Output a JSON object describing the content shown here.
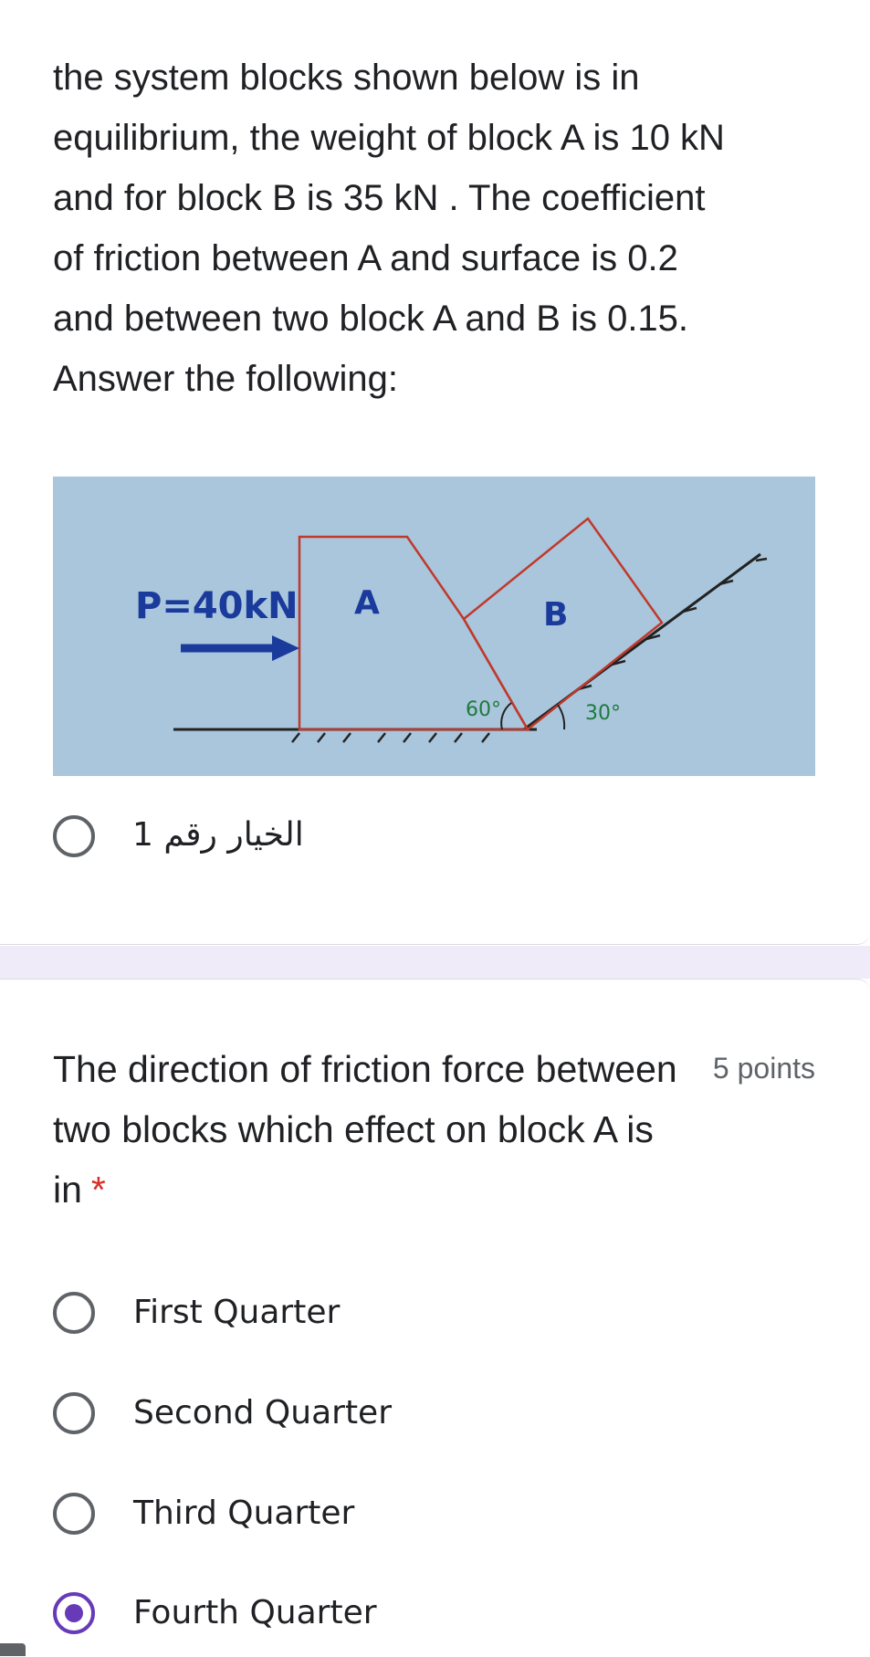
{
  "section_description": {
    "lines": [
      "the system blocks shown below is in",
      "equilibrium, the weight of block A is 10 kN",
      "and for block B is 35 kN . The coefficient",
      "of friction between A and surface is 0.2",
      "and between two block A and B is 0.15.",
      "Answer the following:"
    ]
  },
  "figure": {
    "force_label": "P=40kN",
    "block_a_label": "A",
    "block_b_label": "B",
    "angle_left": "60°",
    "angle_right": "30°"
  },
  "section_option": {
    "label": "الخيار رقم 1",
    "selected": false
  },
  "question": {
    "title": "The direction of friction force between two blocks which effect on block A is in",
    "required_mark": "*",
    "points": "5 points",
    "options": [
      {
        "label": "First Quarter",
        "selected": false
      },
      {
        "label": "Second Quarter",
        "selected": false
      },
      {
        "label": "Third Quarter",
        "selected": false
      },
      {
        "label": "Fourth Quarter",
        "selected": true
      }
    ]
  },
  "colors": {
    "accent": "#673ab7",
    "required": "#d93025",
    "figure_background": "#a9c6dc",
    "block_outline": "#c0392b",
    "ink_blue": "#1a3a9c",
    "ink_green": "#1e7a3c"
  }
}
